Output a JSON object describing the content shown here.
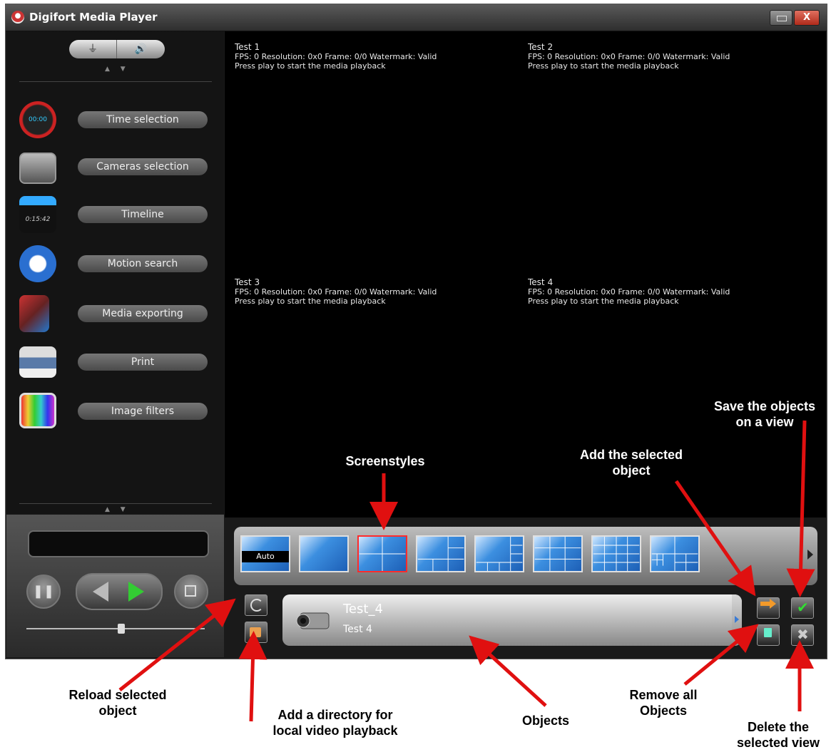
{
  "window": {
    "title": "Digifort Media Player",
    "close_label": "X"
  },
  "sidebar": {
    "arrows": "▲ ▼",
    "items": [
      {
        "label": "Time selection",
        "icon": "clock-icon"
      },
      {
        "label": "Cameras selection",
        "icon": "cameras-icon"
      },
      {
        "label": "Timeline",
        "icon": "clapperboard-icon"
      },
      {
        "label": "Motion search",
        "icon": "motion-search-icon"
      },
      {
        "label": "Media exporting",
        "icon": "film-export-icon"
      },
      {
        "label": "Print",
        "icon": "printer-icon"
      },
      {
        "label": "Image filters",
        "icon": "image-filters-icon"
      }
    ],
    "time_icon_text": "00:00",
    "timeline_icon_text": "0:15:42"
  },
  "video": {
    "cells": [
      {
        "title": "Test 1",
        "info": "FPS: 0    Resolution: 0x0    Frame: 0/0    Watermark: Valid",
        "message": "Press play to start the media playback"
      },
      {
        "title": "Test 2",
        "info": "FPS: 0    Resolution: 0x0    Frame: 0/0    Watermark: Valid",
        "message": "Press play to start the media playback"
      },
      {
        "title": "Test 3",
        "info": "FPS: 0    Resolution: 0x0    Frame: 0/0    Watermark: Valid",
        "message": "Press play to start the media playback"
      },
      {
        "title": "Test 4",
        "info": "FPS: 0    Resolution: 0x0    Frame: 0/0    Watermark: Valid",
        "message": "Press play to start the media playback"
      }
    ]
  },
  "screenstyles": {
    "auto_label": "Auto",
    "selected_index": 2
  },
  "objects": {
    "name": "Test_4",
    "description": "Test 4"
  },
  "annotations": {
    "screenstyles": "Screenstyles",
    "add_selected": "Add the selected\nobject",
    "save_objects": "Save the objects\non a view",
    "reload_selected": "Reload selected\nobject",
    "add_directory": "Add a directory for\nlocal video playback",
    "objects": "Objects",
    "remove_all": "Remove all\nObjects",
    "delete_view": "Delete the\nselected view"
  },
  "colors": {
    "arrow": "#e01010",
    "selection": "#ff2b2b",
    "video_bg": "#000000"
  }
}
